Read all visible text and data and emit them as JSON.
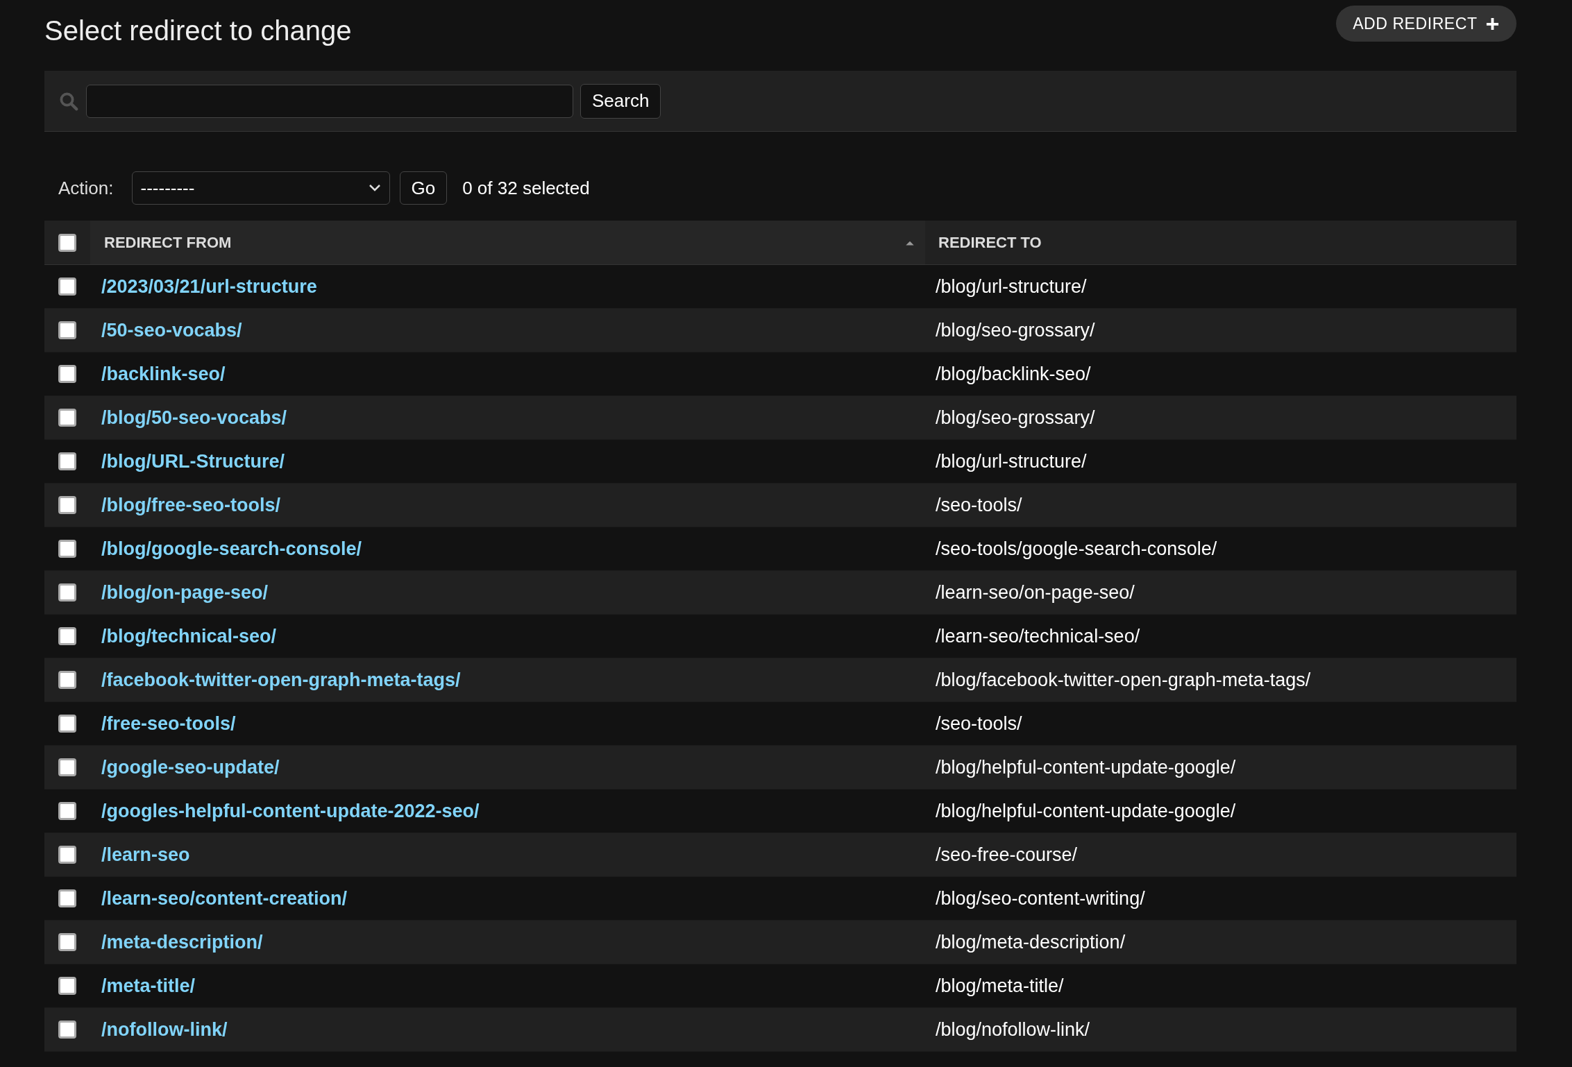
{
  "title": "Select redirect to change",
  "add_button": {
    "label": "ADD REDIRECT",
    "icon": "+"
  },
  "search": {
    "button": "Search"
  },
  "actions": {
    "label": "Action:",
    "value": "---------",
    "button": "Go",
    "counter": "0 of 32 selected"
  },
  "table": {
    "select_all": {
      "checked": false
    },
    "columns": [
      {
        "label": "REDIRECT FROM",
        "sorted": true
      },
      {
        "label": "REDIRECT TO",
        "sorted": false
      }
    ],
    "rows": [
      {
        "from": "/2023/03/21/url-structure",
        "to": "/blog/url-structure/",
        "checked": false
      },
      {
        "from": "/50-seo-vocabs/",
        "to": "/blog/seo-grossary/",
        "checked": false
      },
      {
        "from": "/backlink-seo/",
        "to": "/blog/backlink-seo/",
        "checked": false
      },
      {
        "from": "/blog/50-seo-vocabs/",
        "to": "/blog/seo-grossary/",
        "checked": false
      },
      {
        "from": "/blog/URL-Structure/",
        "to": "/blog/url-structure/",
        "checked": false
      },
      {
        "from": "/blog/free-seo-tools/",
        "to": "/seo-tools/",
        "checked": false
      },
      {
        "from": "/blog/google-search-console/",
        "to": "/seo-tools/google-search-console/",
        "checked": false
      },
      {
        "from": "/blog/on-page-seo/",
        "to": "/learn-seo/on-page-seo/",
        "checked": false
      },
      {
        "from": "/blog/technical-seo/",
        "to": "/learn-seo/technical-seo/",
        "checked": false
      },
      {
        "from": "/facebook-twitter-open-graph-meta-tags/",
        "to": "/blog/facebook-twitter-open-graph-meta-tags/",
        "checked": false
      },
      {
        "from": "/free-seo-tools/",
        "to": "/seo-tools/",
        "checked": false
      },
      {
        "from": "/google-seo-update/",
        "to": "/blog/helpful-content-update-google/",
        "checked": false
      },
      {
        "from": "/googles-helpful-content-update-2022-seo/",
        "to": "/blog/helpful-content-update-google/",
        "checked": false
      },
      {
        "from": "/learn-seo",
        "to": "/seo-free-course/",
        "checked": false
      },
      {
        "from": "/learn-seo/content-creation/",
        "to": "/blog/seo-content-writing/",
        "checked": false
      },
      {
        "from": "/meta-description/",
        "to": "/blog/meta-description/",
        "checked": false
      },
      {
        "from": "/meta-title/",
        "to": "/blog/meta-title/",
        "checked": false
      },
      {
        "from": "/nofollow-link/",
        "to": "/blog/nofollow-link/",
        "checked": false
      }
    ]
  }
}
